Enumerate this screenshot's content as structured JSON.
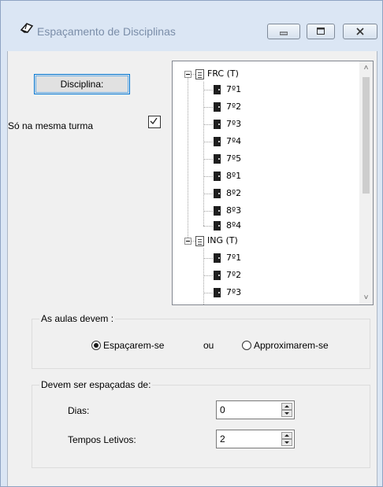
{
  "window": {
    "title": "Espaçamento de Disciplinas"
  },
  "disciplina_button": "Disciplina:",
  "same_class": {
    "label": "Só na mesma turma",
    "checked": true
  },
  "tree": {
    "groups": [
      {
        "label": "FRC (T)",
        "items": [
          "7º1",
          "7º2",
          "7º3",
          "7º4",
          "7º5",
          "8º1",
          "8º2",
          "8º3",
          "8º4"
        ]
      },
      {
        "label": "ING (T)",
        "items": [
          "7º1",
          "7º2",
          "7º3"
        ]
      }
    ]
  },
  "lessons": {
    "legend": "As aulas devem :",
    "option_spread": "Espaçarem-se",
    "or": "ou",
    "option_close": "Approximarem-se",
    "selected": "spread"
  },
  "spacing": {
    "legend": "Devem ser espaçadas de:",
    "days_label": "Dias:",
    "days_value": "0",
    "periods_label": "Tempos Letivos:",
    "periods_value": "2"
  }
}
